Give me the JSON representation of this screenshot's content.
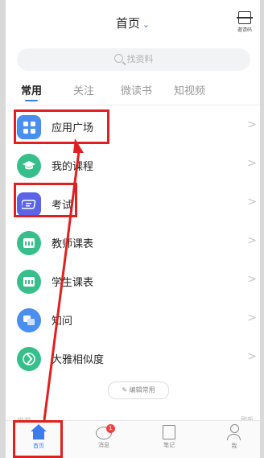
{
  "header": {
    "title": "首页",
    "title_chevron": "⌄",
    "qr_label": "邀请码"
  },
  "search": {
    "placeholder": "找资料"
  },
  "tabs": [
    {
      "label": "常用",
      "active": true
    },
    {
      "label": "关注"
    },
    {
      "label": "微读书"
    },
    {
      "label": "知视频"
    }
  ],
  "list": [
    {
      "label": "应用广场",
      "icon": "app-grid-icon",
      "color": "#4a8ff0"
    },
    {
      "label": "我的课程",
      "icon": "graduation-cap-icon",
      "color": "#36bf8a"
    },
    {
      "label": "考试",
      "icon": "exam-icon",
      "color": "#5b63e6"
    },
    {
      "label": "教师课表",
      "icon": "calendar-icon",
      "color": "#36bf8a"
    },
    {
      "label": "学生课表",
      "icon": "calendar-icon",
      "color": "#36bf8a"
    },
    {
      "label": "知问",
      "icon": "qa-icon",
      "color": "#4a8ff0"
    },
    {
      "label": "大雅相似度",
      "icon": "similarity-icon",
      "color": "#36bf8a"
    }
  ],
  "edit_button": "编辑常用",
  "section_peek": "推荐",
  "refresh_peek": "刷新",
  "bottom_nav": [
    {
      "label": "首页",
      "active": true
    },
    {
      "label": "消息",
      "badge": "1"
    },
    {
      "label": "笔记"
    },
    {
      "label": "我"
    }
  ],
  "colors": {
    "accent": "#3d7bf0",
    "annotation": "#e02020",
    "badge": "#f04141"
  }
}
